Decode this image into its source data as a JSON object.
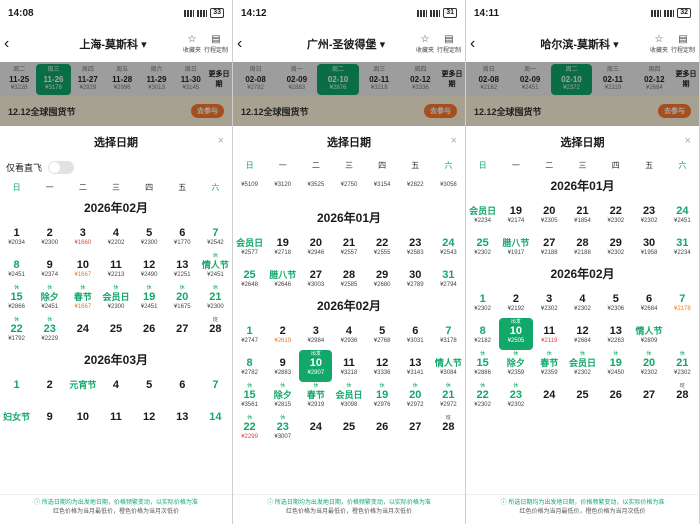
{
  "panels": [
    {
      "time": "14:08",
      "battery": "33",
      "title": "上海-莫斯科",
      "scroll": 0,
      "strip": [
        [
          "周二",
          "11-25",
          "¥3228"
        ],
        [
          "周三",
          "11-26",
          "¥3178"
        ],
        [
          "周四",
          "11-27",
          "¥2929"
        ],
        [
          "周五",
          "11-28",
          "¥2996"
        ],
        [
          "周六",
          "11-29",
          "¥3013"
        ],
        [
          "周日",
          "11-30",
          "¥3145"
        ]
      ],
      "sel": 1,
      "toggle": true,
      "weekTop": true,
      "months": [
        {
          "title": "2026年02月",
          "cells": [
            [
              "",
              "1",
              "¥2034"
            ],
            [
              "",
              "2",
              "¥2300"
            ],
            [
              "",
              "3",
              "¥1660",
              "red"
            ],
            [
              "",
              "4",
              "¥2202"
            ],
            [
              "",
              "5",
              "¥2300"
            ],
            [
              "",
              "6",
              "¥1770"
            ],
            [
              "",
              "7",
              "¥2542",
              "g"
            ],
            [
              "",
              "8",
              "¥2451",
              "g"
            ],
            [
              "",
              "9",
              "¥2374"
            ],
            [
              "",
              "10",
              "¥1667",
              "org"
            ],
            [
              "",
              "11",
              "¥2213"
            ],
            [
              "",
              "12",
              "¥2490"
            ],
            [
              "",
              "13",
              "¥2251"
            ],
            [
              "休",
              "情人节",
              "¥2451",
              "hol txt"
            ],
            [
              "休",
              "15",
              "¥2866",
              "hol"
            ],
            [
              "休",
              "除夕",
              "¥2451",
              "hol txt"
            ],
            [
              "休",
              "春节",
              "¥1667",
              "hol txt org"
            ],
            [
              "休",
              "会员日",
              "¥2300",
              "hol txt"
            ],
            [
              "休",
              "19",
              "¥2451",
              "hol"
            ],
            [
              "休",
              "20",
              "¥1675",
              "hol"
            ],
            [
              "休",
              "21",
              "¥2300",
              "hol"
            ],
            [
              "休",
              "22",
              "¥1792",
              "hol"
            ],
            [
              "休",
              "23",
              "¥2229",
              "hol"
            ],
            [
              "",
              "24",
              ""
            ],
            [
              "",
              "25",
              ""
            ],
            [
              "",
              "26",
              ""
            ],
            [
              "",
              "27",
              ""
            ],
            [
              "班",
              "28",
              "",
              "wd"
            ]
          ]
        },
        {
          "title": "2026年03月",
          "cells": [
            [
              "",
              "1",
              "",
              "g"
            ],
            [
              "",
              "2",
              ""
            ],
            [
              "",
              "元宵节",
              "",
              "hol txt"
            ],
            [
              "",
              "4",
              ""
            ],
            [
              "",
              "5",
              ""
            ],
            [
              "",
              "6",
              ""
            ],
            [
              "",
              "7",
              "",
              "g"
            ],
            [
              "",
              "妇女节",
              "",
              "hol txt"
            ],
            [
              "",
              "9",
              ""
            ],
            [
              "",
              "10",
              ""
            ],
            [
              "",
              "11",
              ""
            ],
            [
              "",
              "12",
              ""
            ],
            [
              "",
              "13",
              ""
            ],
            [
              "",
              "14",
              "",
              "g"
            ]
          ]
        }
      ]
    },
    {
      "time": "14:12",
      "battery": "31",
      "title": "广州-圣彼得堡",
      "scroll": 1,
      "strip": [
        [
          "周日",
          "02-08",
          "¥2782"
        ],
        [
          "周一",
          "02-09",
          "¥2883"
        ],
        [
          "周二",
          "02-10",
          "¥2876"
        ],
        [
          "周三",
          "02-11",
          "¥3218"
        ],
        [
          "周四",
          "02-12",
          "¥3336"
        ]
      ],
      "sel": 2,
      "toggle": false,
      "weekTop": true,
      "months": [
        {
          "title": "",
          "cells": [
            [
              "",
              "",
              "¥5109"
            ],
            [
              "",
              "",
              "¥3120"
            ],
            [
              "",
              "",
              "¥3525"
            ],
            [
              "",
              "",
              "¥2750"
            ],
            [
              "",
              "",
              "¥3154"
            ],
            [
              "",
              "",
              "¥2822"
            ],
            [
              "",
              "",
              "¥3058"
            ]
          ]
        },
        {
          "title": "2026年01月",
          "cells": [
            [
              "",
              "会员日",
              "¥2577",
              "hol txt"
            ],
            [
              "",
              "19",
              "¥2718"
            ],
            [
              "",
              "20",
              "¥2946"
            ],
            [
              "",
              "21",
              "¥2557"
            ],
            [
              "",
              "22",
              "¥2555"
            ],
            [
              "",
              "23",
              "¥2583"
            ],
            [
              "",
              "24",
              "¥2543",
              "g"
            ],
            [
              "",
              "25",
              "¥2648",
              "g"
            ],
            [
              "",
              "腊八节",
              "¥2646",
              "hol txt"
            ],
            [
              "",
              "27",
              "¥3003"
            ],
            [
              "",
              "28",
              "¥2585"
            ],
            [
              "",
              "29",
              "¥2680"
            ],
            [
              "",
              "30",
              "¥2789"
            ],
            [
              "",
              "31",
              "¥2794",
              "g"
            ]
          ]
        },
        {
          "title": "2026年02月",
          "cells": [
            [
              "",
              "1",
              "¥2747",
              "g"
            ],
            [
              "",
              "2",
              "¥2619",
              "org"
            ],
            [
              "",
              "3",
              "¥2984"
            ],
            [
              "",
              "4",
              "¥2936"
            ],
            [
              "",
              "5",
              "¥2768"
            ],
            [
              "",
              "6",
              "¥3031"
            ],
            [
              "",
              "7",
              "¥3178",
              "g"
            ],
            [
              "",
              "8",
              "¥2782",
              "g"
            ],
            [
              "",
              "9",
              "¥2883"
            ],
            [
              "出发",
              "10",
              "¥2907",
              "sel"
            ],
            [
              "",
              "11",
              "¥3218"
            ],
            [
              "",
              "12",
              "¥3336"
            ],
            [
              "",
              "13",
              "¥3141"
            ],
            [
              "",
              "情人节",
              "¥3084",
              "hol txt"
            ],
            [
              "休",
              "15",
              "¥3561",
              "hol"
            ],
            [
              "休",
              "除夕",
              "¥2815",
              "hol txt"
            ],
            [
              "休",
              "春节",
              "¥2919",
              "hol txt"
            ],
            [
              "休",
              "会员日",
              "¥3098",
              "hol txt"
            ],
            [
              "休",
              "19",
              "¥2976",
              "hol"
            ],
            [
              "休",
              "20",
              "¥2972",
              "hol"
            ],
            [
              "休",
              "21",
              "¥2972",
              "hol"
            ],
            [
              "休",
              "22",
              "¥2299",
              "hol red"
            ],
            [
              "休",
              "23",
              "¥3007",
              "hol"
            ],
            [
              "",
              "24",
              ""
            ],
            [
              "",
              "25",
              ""
            ],
            [
              "",
              "26",
              ""
            ],
            [
              "",
              "27",
              ""
            ],
            [
              "班",
              "28",
              "",
              "wd"
            ]
          ]
        }
      ]
    },
    {
      "time": "14:11",
      "battery": "32",
      "title": "哈尔滨-莫斯科",
      "scroll": 1,
      "strip": [
        [
          "周日",
          "02-08",
          "¥2182"
        ],
        [
          "周一",
          "02-09",
          "¥2451"
        ],
        [
          "周二",
          "02-10",
          "¥2372"
        ],
        [
          "周三",
          "02-11",
          "¥2119"
        ],
        [
          "周四",
          "02-12",
          "¥2684"
        ]
      ],
      "sel": 2,
      "toggle": false,
      "weekTop": true,
      "months": [
        {
          "title": "2026年01月",
          "cells": [
            [
              "",
              "会员日",
              "¥2234",
              "hol txt"
            ],
            [
              "",
              "19",
              "¥2174"
            ],
            [
              "",
              "20",
              "¥2305"
            ],
            [
              "",
              "21",
              "¥1854"
            ],
            [
              "",
              "22",
              "¥2302"
            ],
            [
              "",
              "23",
              "¥2302"
            ],
            [
              "",
              "24",
              "¥2451",
              "g"
            ],
            [
              "",
              "25",
              "¥2302",
              "g"
            ],
            [
              "",
              "腊八节",
              "¥1917",
              "hol txt"
            ],
            [
              "",
              "27",
              "¥2188"
            ],
            [
              "",
              "28",
              "¥2188"
            ],
            [
              "",
              "29",
              "¥2302"
            ],
            [
              "",
              "30",
              "¥1958"
            ],
            [
              "",
              "31",
              "¥2234",
              "g"
            ]
          ]
        },
        {
          "title": "2026年02月",
          "cells": [
            [
              "",
              "1",
              "¥2302",
              "g"
            ],
            [
              "",
              "2",
              "¥2192"
            ],
            [
              "",
              "3",
              "¥2302"
            ],
            [
              "",
              "4",
              "¥2302"
            ],
            [
              "",
              "5",
              "¥2306"
            ],
            [
              "",
              "6",
              "¥2684"
            ],
            [
              "",
              "7",
              "¥2178",
              "g org"
            ],
            [
              "",
              "8",
              "¥2182",
              "g"
            ],
            [
              "出发",
              "10",
              "¥2505",
              "sel"
            ],
            [
              "",
              "11",
              "¥2119",
              "red"
            ],
            [
              "",
              "12",
              "¥2684"
            ],
            [
              "",
              "13",
              "¥2263"
            ],
            [
              "",
              "情人节",
              "¥2809",
              "hol txt"
            ],
            [
              "",
              "",
              ""
            ],
            [
              "休",
              "15",
              "¥2886",
              "hol"
            ],
            [
              "休",
              "除夕",
              "¥2359",
              "hol txt"
            ],
            [
              "休",
              "春节",
              "¥2359",
              "hol txt"
            ],
            [
              "休",
              "会员日",
              "¥2302",
              "hol txt"
            ],
            [
              "休",
              "19",
              "¥2450",
              "hol"
            ],
            [
              "休",
              "20",
              "¥2302",
              "hol"
            ],
            [
              "休",
              "21",
              "¥2302",
              "hol"
            ],
            [
              "休",
              "22",
              "¥2302",
              "hol"
            ],
            [
              "休",
              "23",
              "¥2302",
              "hol"
            ],
            [
              "",
              "24",
              ""
            ],
            [
              "",
              "25",
              ""
            ],
            [
              "",
              "26",
              ""
            ],
            [
              "",
              "27",
              ""
            ],
            [
              "班",
              "28",
              "",
              "wd"
            ]
          ]
        }
      ]
    }
  ],
  "ui": {
    "modal_title": "选择日期",
    "toggle_label": "仅看直飞",
    "more": "更多日期",
    "favorite": "收藏夹",
    "itinerary": "行程定制",
    "banner": "12.12全球囤货节",
    "banner_btn": "去参与",
    "close": "×",
    "weekdays": [
      "日",
      "一",
      "二",
      "三",
      "四",
      "五",
      "六"
    ],
    "footer1": "所选日期均为出发地日期，价格频繁变动，以实际价格为准",
    "footer2": "红色价格为当月最低价，橙色价格为当月次低价"
  }
}
